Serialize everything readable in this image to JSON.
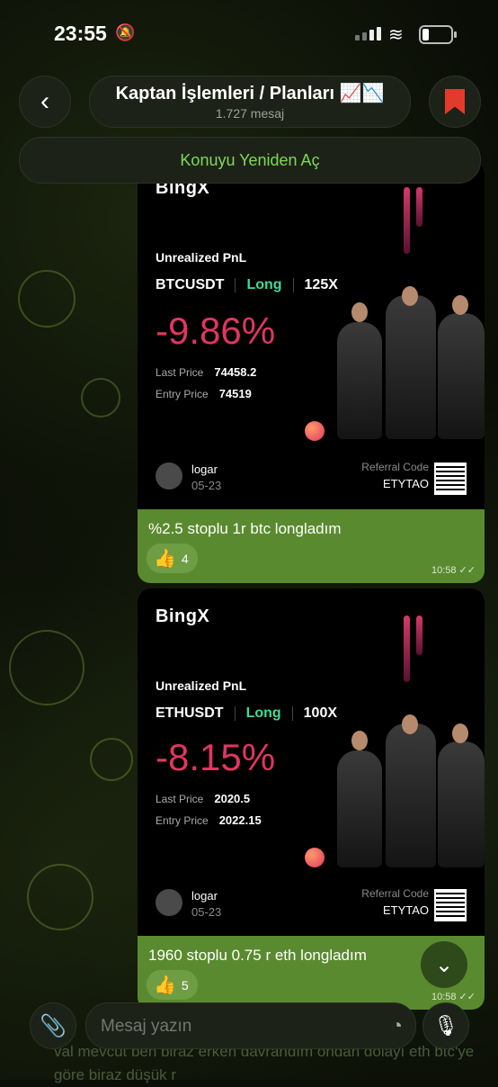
{
  "status": {
    "time": "23:55",
    "bell": "🔕",
    "wifi": "📶"
  },
  "header": {
    "back_icon": "‹",
    "title": "Kaptan İşlemleri / Planları 📈📉",
    "subtitle": "1.727 mesaj"
  },
  "reopen_label": "Konuyu Yeniden Aç",
  "messages": [
    {
      "logo": "BingX",
      "upnl_label": "Unrealized PnL",
      "symbol": "BTCUSDT",
      "side": "Long",
      "leverage": "125X",
      "pnl": "-9.86%",
      "last_price_label": "Last Price",
      "last_price": "74458.2",
      "entry_price_label": "Entry Price",
      "entry_price": "74519",
      "user": "logar",
      "date": "05-23",
      "ref_label": "Referral Code",
      "ref_code": "ETYTAO",
      "caption": "%2.5 stoplu 1r btc longladım",
      "reaction_emoji": "👍",
      "reaction_count": "4",
      "time": "10:58 ✓✓"
    },
    {
      "logo": "BingX",
      "upnl_label": "Unrealized PnL",
      "symbol": "ETHUSDT",
      "side": "Long",
      "leverage": "100X",
      "pnl": "-8.15%",
      "last_price_label": "Last Price",
      "last_price": "2020.5",
      "entry_price_label": "Entry Price",
      "entry_price": "2022.15",
      "user": "logar",
      "date": "05-23",
      "ref_label": "Referral Code",
      "ref_code": "ETYTAO",
      "caption": "1960 stoplu 0.75 r eth longladım",
      "reaction_emoji": "👍",
      "reaction_count": "5",
      "time": "10:58 ✓✓"
    }
  ],
  "composer": {
    "placeholder": "Mesaj yazın",
    "attach_icon": "📎",
    "sticker_icon": "◔",
    "mic_icon": "🎙",
    "scroll_icon": "⌄"
  },
  "underlay_text": "val mevcut ben biraz erken davrandım ondan dolayı eth btc'ye göre biraz düşük r"
}
